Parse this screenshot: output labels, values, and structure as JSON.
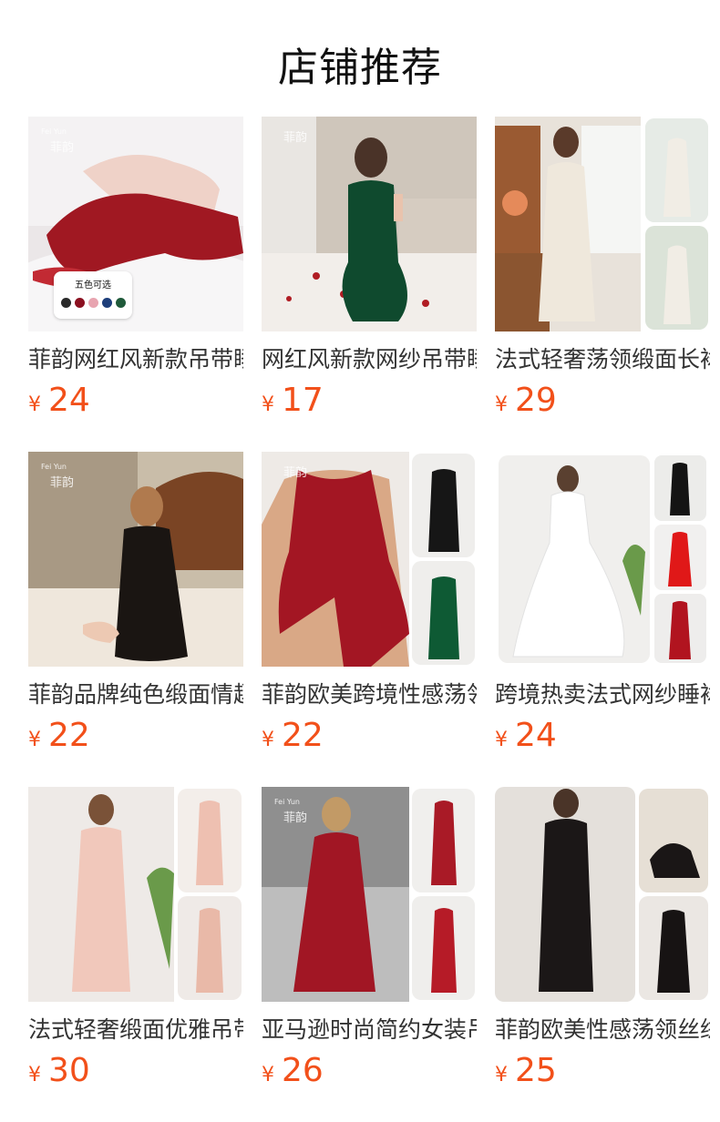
{
  "header": {
    "title": "店铺推荐"
  },
  "products": [
    {
      "name": "菲韵网红风新款吊带睡裙",
      "currency": "¥",
      "price": "24",
      "watermark": "菲韵",
      "watermark_sub": "Fei Yun",
      "badge": "五色可选",
      "swatches": [
        "#2a2a2a",
        "#8b1020",
        "#e8a4b0",
        "#1d3e7a",
        "#1f5a3a"
      ],
      "colors": {
        "bg": "#e9e4e4",
        "dress": "#a01822",
        "skin": "#efd2c8"
      }
    },
    {
      "name": "网红风新款网纱吊带睡裙",
      "currency": "¥",
      "price": "17",
      "watermark": "菲韵",
      "colors": {
        "bg": "#d8cfc4",
        "dress": "#0f4a2e",
        "skin": "#e9c3ad"
      }
    },
    {
      "name": "法式轻奢荡领缎面长裙",
      "currency": "¥",
      "price": "29",
      "colors": {
        "bg": "#eae5de",
        "dress": "#efe8dc",
        "skin": "#e8c6ae"
      }
    },
    {
      "name": "菲韵品牌纯色缎面情趣睡裙",
      "currency": "¥",
      "price": "22",
      "watermark": "菲韵",
      "watermark_sub": "Fei Yun",
      "colors": {
        "bg": "#7a5a3e",
        "dress": "#1a1512",
        "skin": "#edc9b3"
      }
    },
    {
      "name": "菲韵欧美跨境性感荡领睡裙",
      "currency": "¥",
      "price": "22",
      "watermark": "菲韵",
      "colors": {
        "bg": "#eeeae6",
        "dress": "#a31623",
        "skin": "#d9a886"
      }
    },
    {
      "name": "跨境热卖法式网纱睡裙",
      "currency": "¥",
      "price": "24",
      "colors": {
        "bg": "#f2f2f2",
        "dress": "#ffffff",
        "skin": "#d8b49c"
      }
    },
    {
      "name": "法式轻奢缎面优雅吊带裙",
      "currency": "¥",
      "price": "30",
      "colors": {
        "bg": "#f0ecea",
        "dress": "#f1c8bb",
        "skin": "#e1b59b"
      }
    },
    {
      "name": "亚马逊时尚简约女装吊带裙",
      "currency": "¥",
      "price": "26",
      "watermark": "菲韵",
      "watermark_sub": "Fei Yun",
      "colors": {
        "bg": "#9c9c9c",
        "dress": "#a11624",
        "skin": "#e2b798"
      }
    },
    {
      "name": "菲韵欧美性感荡领丝绒长裙",
      "currency": "¥",
      "price": "25",
      "colors": {
        "bg": "#e6e2dd",
        "dress": "#1b1717",
        "skin": "#d8ad92"
      }
    }
  ]
}
